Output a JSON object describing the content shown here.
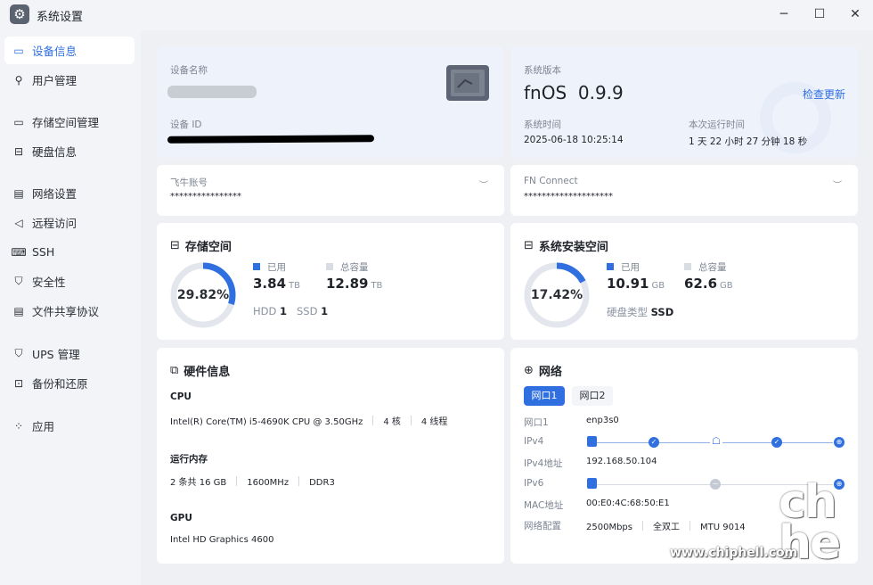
{
  "window": {
    "title": "系统设置",
    "minimize": "─",
    "maximize": "☐",
    "close": "✕"
  },
  "sidebar": {
    "items": [
      {
        "label": "设备信息",
        "icon": "▭"
      },
      {
        "label": "用户管理",
        "icon": "⚲"
      },
      {
        "label": "存储空间管理",
        "icon": "▭"
      },
      {
        "label": "硬盘信息",
        "icon": "⊟"
      },
      {
        "label": "网络设置",
        "icon": "▤"
      },
      {
        "label": "远程访问",
        "icon": "◁"
      },
      {
        "label": "SSH",
        "icon": "⌨"
      },
      {
        "label": "安全性",
        "icon": "⛉"
      },
      {
        "label": "文件共享协议",
        "icon": "▤"
      },
      {
        "label": "UPS 管理",
        "icon": "⛉"
      },
      {
        "label": "备份和还原",
        "icon": "⊡"
      },
      {
        "label": "应用",
        "icon": "⁘"
      }
    ]
  },
  "device": {
    "name_label": "设备名称",
    "id_label": "设备 ID"
  },
  "system": {
    "version_label": "系统版本",
    "os_name": "fnOS",
    "version": "0.9.9",
    "check_update": "检查更新",
    "time_label": "系统时间",
    "time": "2025-06-18 10:25:14",
    "uptime_label": "本次运行时间",
    "uptime": "1 天 22 小时 27 分钟 18 秒"
  },
  "account": {
    "label": "飞牛账号",
    "value": "****************"
  },
  "fnconnect": {
    "label": "FN Connect",
    "value": "********************"
  },
  "storage": {
    "title": "存储空间",
    "percent": "29.82%",
    "percent_value": 29.82,
    "used_label": "已用",
    "used_value": "3.84",
    "used_unit": "TB",
    "total_label": "总容量",
    "total_value": "12.89",
    "total_unit": "TB",
    "hdd_label": "HDD",
    "hdd_count": "1",
    "ssd_label": "SSD",
    "ssd_count": "1"
  },
  "sysinstall": {
    "title": "系统安装空间",
    "percent": "17.42%",
    "percent_value": 17.42,
    "used_label": "已用",
    "used_value": "10.91",
    "used_unit": "GB",
    "total_label": "总容量",
    "total_value": "62.6",
    "total_unit": "GB",
    "disk_type_label": "硬盘类型",
    "disk_type": "SSD"
  },
  "hardware": {
    "title": "硬件信息",
    "cpu_label": "CPU",
    "cpu_model": "Intel(R) Core(TM) i5-4690K CPU @ 3.50GHz",
    "cpu_cores": "4 核",
    "cpu_threads": "4 线程",
    "mem_label": "运行内存",
    "mem_total": "2 条共 16 GB",
    "mem_freq": "1600MHz",
    "mem_type": "DDR3",
    "gpu_label": "GPU",
    "gpu_model": "Intel HD Graphics 4600"
  },
  "network": {
    "title": "网络",
    "tabs": [
      "网口1",
      "网口2"
    ],
    "port_label": "网口1",
    "port_name": "enp3s0",
    "ipv4_label": "IPv4",
    "ipv4_addr_label": "IPv4地址",
    "ipv4_addr": "192.168.50.104",
    "ipv6_label": "IPv6",
    "mac_label": "MAC地址",
    "mac": "00:E0:4C:68:50:E1",
    "config_label": "网络配置",
    "speed": "2500Mbps",
    "duplex": "全双工",
    "mtu": "MTU 9014"
  },
  "watermark": {
    "text": "www.chiphell.com"
  },
  "colors": {
    "accent": "#2f6fe0",
    "ring_bg": "#e3e6ec",
    "legend_total": "#d8dce3"
  }
}
